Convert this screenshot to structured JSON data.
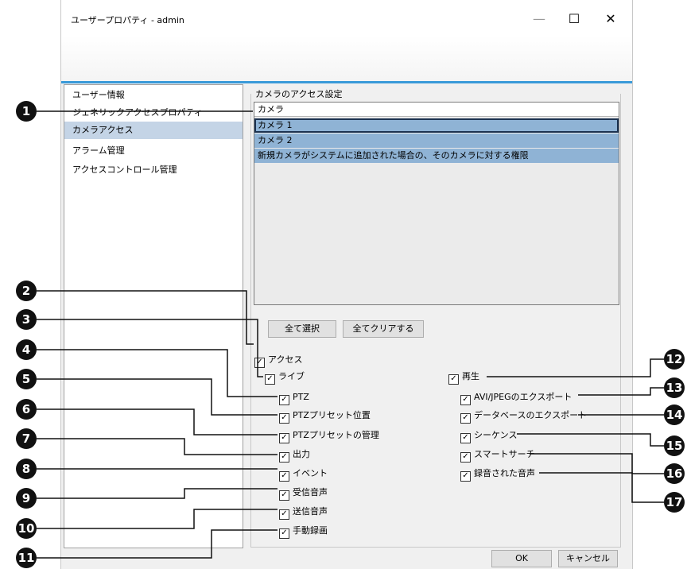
{
  "window": {
    "title": "ユーザープロパティ - admin",
    "minimize": "—",
    "maximize": "☐",
    "close": "✕"
  },
  "sidebar": {
    "items": [
      {
        "label": "ユーザー情報",
        "selected": false
      },
      {
        "label": "ジェネリックアクセスプロパティ",
        "selected": false
      },
      {
        "label": "カメラアクセス",
        "selected": true
      },
      {
        "label": "アラーム管理",
        "selected": false
      },
      {
        "label": "アクセスコントロール管理",
        "selected": false
      }
    ]
  },
  "camera_access": {
    "group_label": "カメラのアクセス設定",
    "column_header": "カメラ",
    "rows": [
      "カメラ 1",
      "カメラ 2",
      "新規カメラがシステムに追加された場合の、そのカメラに対する権限"
    ],
    "select_all": "全て選択",
    "clear_all": "全てクリアする"
  },
  "permissions": {
    "access": "アクセス",
    "live": "ライブ",
    "ptz": "PTZ",
    "ptz_preset_position": "PTZプリセット位置",
    "ptz_preset_management": "PTZプリセットの管理",
    "output": "出力",
    "event": "イベント",
    "receive_audio": "受信音声",
    "send_audio": "送信音声",
    "manual_recording": "手動録画",
    "playback": "再生",
    "avi_jpeg_export": "AVI/JPEGのエクスポート",
    "database_export": "データベースのエクスポート",
    "sequence": "シーケンス",
    "smart_search": "スマートサーチ",
    "recorded_audio": "録音された音声",
    "checked": true
  },
  "footer": {
    "ok": "OK",
    "cancel": "キャンセル"
  },
  "callouts": [
    "1",
    "2",
    "3",
    "4",
    "5",
    "6",
    "7",
    "8",
    "9",
    "10",
    "11",
    "12",
    "13",
    "14",
    "15",
    "16",
    "17"
  ]
}
